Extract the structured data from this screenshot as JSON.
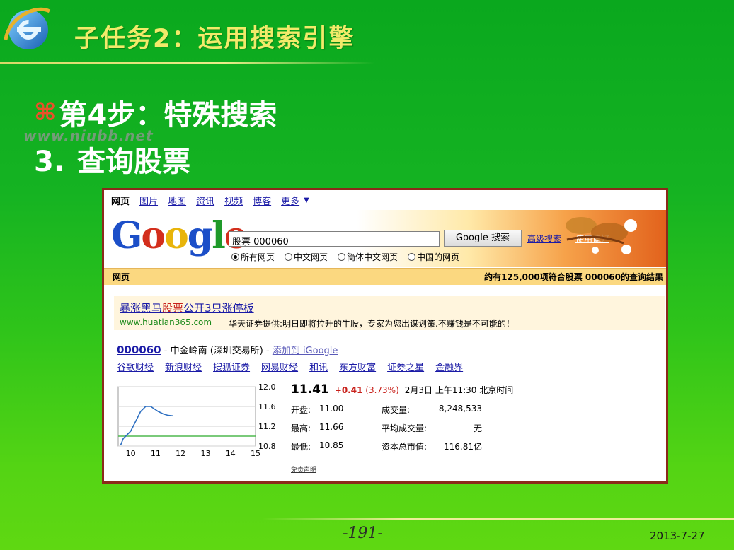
{
  "slide": {
    "title": "子任务2：运用搜索引擎",
    "step_symbol": "⌘",
    "step": "第4步：特殊搜索",
    "watermark": "www.niubb.net",
    "substep_num": "3.",
    "substep_text": "查询股票",
    "page_number": "-191-",
    "date": "2013-7-27"
  },
  "google": {
    "nav": [
      "网页",
      "图片",
      "地图",
      "资讯",
      "视频",
      "博客",
      "更多"
    ],
    "logo": "Google",
    "search_value": "股票 000060",
    "search_button": "Google 搜索",
    "advanced_link": "高级搜索",
    "prefs_link": "使用偏好",
    "radios": [
      "所有网页",
      "中文网页",
      "简体中文网页",
      "中国的网页"
    ],
    "result_bar_left": "网页",
    "result_bar_right": "约有125,000项符合股票 000060的查询结果",
    "ad": {
      "title_a": "暴涨黑马",
      "title_hl": "股票",
      "title_b": "公开3只涨停板",
      "url": "www.huatian365.com",
      "desc": "华天证券提供:明日即将拉升的牛股，专家为您出谋划策.不赚钱是不可能的！"
    },
    "stock": {
      "symbol": "000060",
      "info": " - 中金岭南 (深圳交易所) - ",
      "add_link": "添加到 iGoogle",
      "finance_links": [
        "谷歌财经",
        "新浪财经",
        "搜狐证券",
        "网易财经",
        "和讯",
        "东方财富",
        "证券之星",
        "金融界"
      ],
      "price": "11.41",
      "change": "+0.41",
      "change_pct": "(3.73%)",
      "time": "2月3日 上午11:30 北京时间",
      "rows": [
        {
          "label": "开盘:",
          "value": "11.00",
          "label2": "成交量:",
          "value2": "8,248,533"
        },
        {
          "label": "最高:",
          "value": "11.66",
          "label2": "平均成交量:",
          "value2": "无"
        },
        {
          "label": "最低:",
          "value": "10.85",
          "label2": "资本总市值:",
          "value2": "116.81亿"
        }
      ],
      "disclaimer": "免责声明"
    }
  },
  "chart_data": {
    "type": "line",
    "x_ticks": [
      "10",
      "11",
      "12",
      "13",
      "14",
      "15"
    ],
    "y_ticks": [
      "12.0",
      "11.6",
      "11.2",
      "10.8"
    ],
    "ylim": [
      10.8,
      12.0
    ],
    "xlim": [
      9.5,
      15
    ],
    "reference_line": 11.0,
    "series": [
      {
        "points": [
          [
            9.6,
            10.82
          ],
          [
            9.7,
            10.95
          ],
          [
            9.8,
            11.0
          ],
          [
            10.0,
            11.1
          ],
          [
            10.2,
            11.3
          ],
          [
            10.4,
            11.5
          ],
          [
            10.6,
            11.6
          ],
          [
            10.8,
            11.6
          ],
          [
            10.95,
            11.55
          ],
          [
            11.1,
            11.5
          ],
          [
            11.3,
            11.45
          ],
          [
            11.5,
            11.42
          ],
          [
            11.7,
            11.41
          ]
        ]
      }
    ],
    "colors": {
      "line": "#2d6fc1",
      "ref": "#4fb94f"
    }
  }
}
